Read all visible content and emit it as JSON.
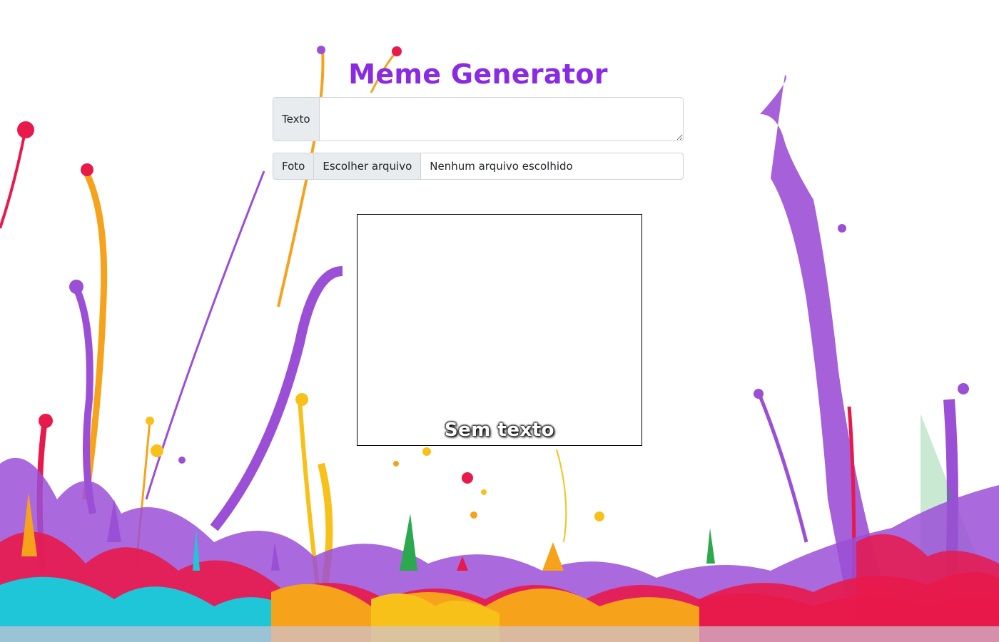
{
  "page": {
    "title": "Meme Generator",
    "title_color": "#8a2be2"
  },
  "form": {
    "text_label": "Texto",
    "text_value": "",
    "photo_label": "Foto",
    "file_button": "Escolher arquivo",
    "file_status": "Nenhum arquivo escolhido"
  },
  "meme": {
    "caption": "Sem texto"
  },
  "background": {
    "description_icon": "paint-splash-background",
    "colors": [
      "#e8194b",
      "#f7a21b",
      "#9b4fd6",
      "#1fc6d8",
      "#f8c11a",
      "#2ca84e"
    ]
  }
}
